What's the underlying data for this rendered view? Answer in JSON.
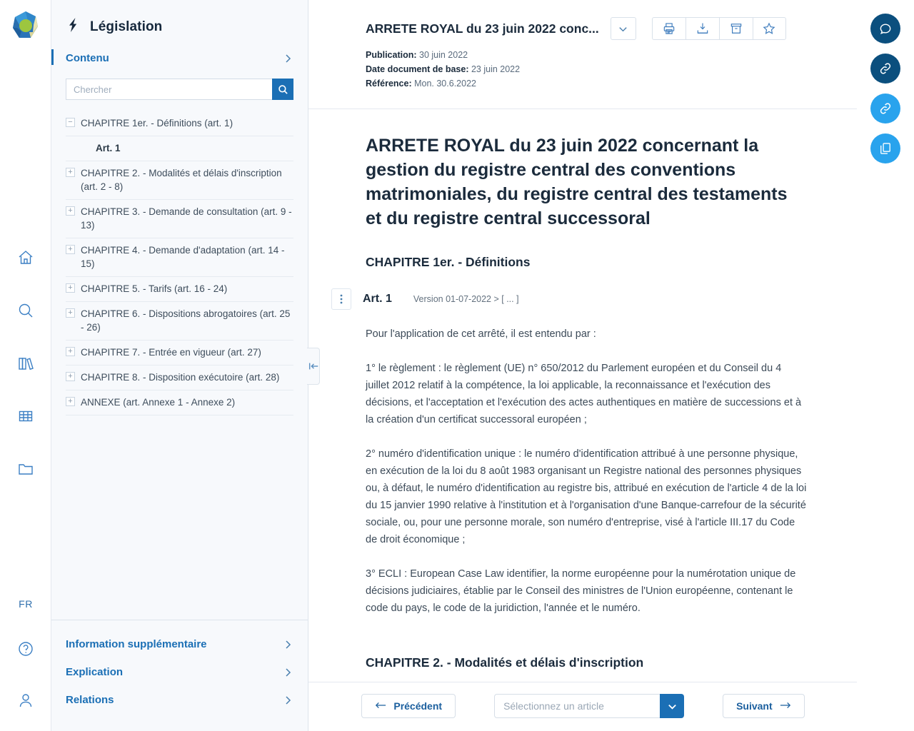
{
  "brand": {
    "logo_alt": "globe-logo",
    "accent": "#1b6fb5",
    "dark_accent": "#0b5181",
    "light_accent": "#2fa8ef"
  },
  "rail": {
    "items": [
      {
        "name": "home-icon",
        "label": "Accueil"
      },
      {
        "name": "search-icon",
        "label": "Recherche"
      },
      {
        "name": "library-icon",
        "label": "Bibliothèque"
      },
      {
        "name": "table-icon",
        "label": "Tableaux"
      },
      {
        "name": "folder-icon",
        "label": "Dossiers"
      }
    ],
    "language": "FR",
    "bottom": [
      {
        "name": "help-icon",
        "label": "Aide"
      },
      {
        "name": "user-icon",
        "label": "Profil"
      }
    ]
  },
  "sidebar": {
    "title": "Législation",
    "title_icon": "legislation-icon",
    "section": {
      "label": "Contenu",
      "chevron": "chevron-right-icon"
    },
    "search": {
      "placeholder": "Chercher",
      "value": "",
      "button_icon": "search-icon"
    },
    "tree": [
      {
        "toggle": "−",
        "label": "CHAPITRE 1er. - Définitions (art. 1)",
        "leaf": false
      },
      {
        "toggle": "",
        "label": "Art. 1",
        "leaf": true
      },
      {
        "toggle": "+",
        "label": "CHAPITRE 2. - Modalités et délais d'inscription (art. 2 - 8)",
        "leaf": false
      },
      {
        "toggle": "+",
        "label": "CHAPITRE 3. - Demande de consultation (art. 9 - 13)",
        "leaf": false
      },
      {
        "toggle": "+",
        "label": "CHAPITRE 4. - Demande d'adaptation (art. 14 - 15)",
        "leaf": false
      },
      {
        "toggle": "+",
        "label": "CHAPITRE 5. - Tarifs (art. 16 - 24)",
        "leaf": false
      },
      {
        "toggle": "+",
        "label": "CHAPITRE 6. - Dispositions abrogatoires (art. 25 - 26)",
        "leaf": false
      },
      {
        "toggle": "+",
        "label": "CHAPITRE 7. - Entrée en vigueur (art. 27)",
        "leaf": false
      },
      {
        "toggle": "+",
        "label": "CHAPITRE 8. - Disposition exécutoire (art. 28)",
        "leaf": false
      },
      {
        "toggle": "+",
        "label": "ANNEXE (art. Annexe 1 - Annexe 2)",
        "leaf": false
      }
    ],
    "footer": [
      {
        "label": "Information supplémentaire"
      },
      {
        "label": "Explication"
      },
      {
        "label": "Relations"
      }
    ],
    "collapse_handle_icon": "collapse-panel-icon"
  },
  "document": {
    "header": {
      "short_title": "ARRETE ROYAL du 23 juin 2022 conc...",
      "expand_icon": "chevron-down-icon",
      "actions": [
        {
          "name": "print-icon",
          "label": "Imprimer"
        },
        {
          "name": "download-icon",
          "label": "Télécharger"
        },
        {
          "name": "archive-icon",
          "label": "Archiver"
        },
        {
          "name": "star-icon",
          "label": "Favori"
        }
      ],
      "meta": [
        {
          "label": "Publication:",
          "value": "30 juin 2022"
        },
        {
          "label": "Date document de base:",
          "value": "23 juin 2022"
        },
        {
          "label": "Référence:",
          "value": "Mon. 30.6.2022"
        }
      ]
    },
    "title": "ARRETE ROYAL du 23 juin 2022 concernant la gestion du registre central des conventions matrimoniales, du registre central des testaments et du registre central successoral",
    "chapter1_heading": "CHAPITRE 1er. - Définitions",
    "article": {
      "menu_icon": "kebab-menu-icon",
      "number": "Art. 1",
      "version": "Version 01-07-2022 > [ ... ]"
    },
    "paragraphs": [
      "Pour l'application de cet arrêté, il est entendu par :",
      "1° le règlement : le règlement (UE) n° 650/2012 du Parlement européen et du Conseil du 4 juillet 2012 relatif à la compétence, la loi applicable, la reconnaissance et l'exécution des décisions, et l'acceptation et l'exécution des actes authentiques en matière de successions et à la création d'un certificat successoral européen ;",
      "2° numéro d'identification unique : le numéro d'identification attribué à une personne physique, en exécution de la loi du 8 août 1983 organisant un Registre national des personnes physiques ou, à défaut, le numéro d'identification au registre bis, attribué en exécution de l'article 4 de la loi du 15 janvier 1990 relative à l'institution et à l'organisation d'une Banque-carrefour de la sécurité sociale, ou, pour une personne morale, son numéro d'entreprise, visé à l'article III.17 du Code de droit économique ;",
      "3° ECLI : European Case Law identifier, la norme européenne pour la numérotation unique de décisions judiciaires, établie par le Conseil des ministres de l'Union européenne, contenant le code du pays, le code de la juridiction, l'année et le numéro."
    ],
    "chapter2_heading": "CHAPITRE 2. - Modalités et délais d'inscription"
  },
  "footer_nav": {
    "previous_label": "Précédent",
    "previous_icon": "arrow-left-icon",
    "select_placeholder": "Sélectionnez un article",
    "select_icon": "chevron-down-icon",
    "next_label": "Suivant",
    "next_icon": "arrow-right-icon"
  },
  "right_rail": {
    "buttons": [
      {
        "name": "comment-icon",
        "color": "#0b4f7e",
        "label": "Commentaires"
      },
      {
        "name": "link-icon",
        "color": "#0b4f7e",
        "label": "Lien"
      },
      {
        "name": "link-icon",
        "color": "#29a3ed",
        "label": "Lien actif"
      },
      {
        "name": "copy-icon",
        "color": "#29a3ed",
        "label": "Copier"
      }
    ]
  }
}
